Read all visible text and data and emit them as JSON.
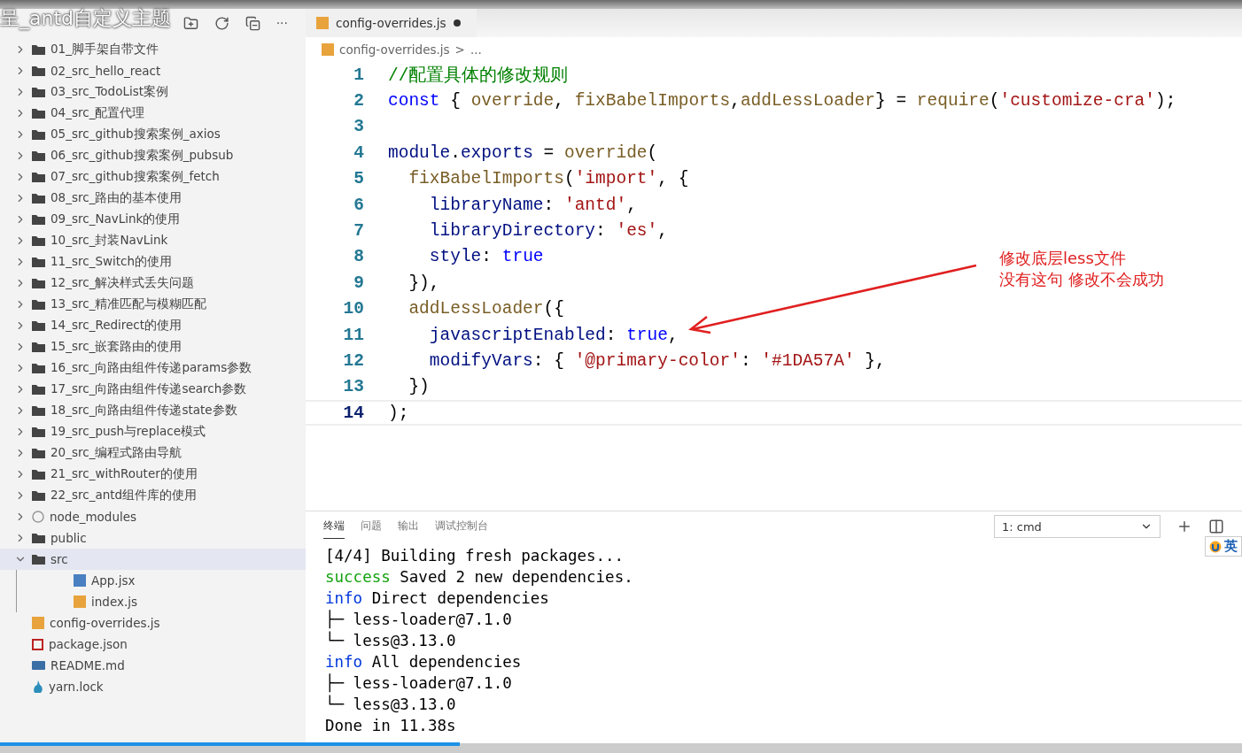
{
  "video_title": "呈_antd自定义主题",
  "explorer": {
    "more": "···",
    "items": [
      {
        "name": "01_脚手架自带文件",
        "kind": "folder",
        "expanded": false,
        "selected": false
      },
      {
        "name": "02_src_hello_react",
        "kind": "folder",
        "expanded": false,
        "selected": false
      },
      {
        "name": "03_src_TodoList案例",
        "kind": "folder",
        "expanded": false,
        "selected": false
      },
      {
        "name": "04_src_配置代理",
        "kind": "folder",
        "expanded": false,
        "selected": false
      },
      {
        "name": "05_src_github搜索案例_axios",
        "kind": "folder",
        "expanded": false,
        "selected": false
      },
      {
        "name": "06_src_github搜索案例_pubsub",
        "kind": "folder",
        "expanded": false,
        "selected": false
      },
      {
        "name": "07_src_github搜索案例_fetch",
        "kind": "folder",
        "expanded": false,
        "selected": false
      },
      {
        "name": "08_src_路由的基本使用",
        "kind": "folder",
        "expanded": false,
        "selected": false
      },
      {
        "name": "09_src_NavLink的使用",
        "kind": "folder",
        "expanded": false,
        "selected": false
      },
      {
        "name": "10_src_封装NavLink",
        "kind": "folder",
        "expanded": false,
        "selected": false
      },
      {
        "name": "11_src_Switch的使用",
        "kind": "folder",
        "expanded": false,
        "selected": false
      },
      {
        "name": "12_src_解决样式丢失问题",
        "kind": "folder",
        "expanded": false,
        "selected": false
      },
      {
        "name": "13_src_精准匹配与模糊匹配",
        "kind": "folder",
        "expanded": false,
        "selected": false
      },
      {
        "name": "14_src_Redirect的使用",
        "kind": "folder",
        "expanded": false,
        "selected": false
      },
      {
        "name": "15_src_嵌套路由的使用",
        "kind": "folder",
        "expanded": false,
        "selected": false
      },
      {
        "name": "16_src_向路由组件传递params参数",
        "kind": "folder",
        "expanded": false,
        "selected": false
      },
      {
        "name": "17_src_向路由组件传递search参数",
        "kind": "folder",
        "expanded": false,
        "selected": false
      },
      {
        "name": "18_src_向路由组件传递state参数",
        "kind": "folder",
        "expanded": false,
        "selected": false
      },
      {
        "name": "19_src_push与replace模式",
        "kind": "folder",
        "expanded": false,
        "selected": false
      },
      {
        "name": "20_src_编程式路由导航",
        "kind": "folder",
        "expanded": false,
        "selected": false
      },
      {
        "name": "21_src_withRouter的使用",
        "kind": "folder",
        "expanded": false,
        "selected": false
      },
      {
        "name": "22_src_antd组件库的使用",
        "kind": "folder",
        "expanded": false,
        "selected": false
      },
      {
        "name": "node_modules",
        "kind": "node",
        "expanded": false,
        "selected": false
      },
      {
        "name": "public",
        "kind": "folder",
        "expanded": false,
        "selected": false
      },
      {
        "name": "src",
        "kind": "folder",
        "expanded": true,
        "selected": true,
        "children": [
          {
            "name": "App.jsx",
            "kind": "jsx",
            "selected": false
          },
          {
            "name": "index.js",
            "kind": "js",
            "selected": false
          }
        ]
      },
      {
        "name": "config-overrides.js",
        "kind": "js",
        "selected": false
      },
      {
        "name": "package.json",
        "kind": "json",
        "selected": false
      },
      {
        "name": "README.md",
        "kind": "md",
        "selected": false
      },
      {
        "name": "yarn.lock",
        "kind": "yarn",
        "selected": false
      }
    ]
  },
  "editor": {
    "tab": {
      "name": "config-overrides.js",
      "modified": true
    },
    "breadcrumb": [
      "config-overrides.js",
      ">",
      "..."
    ],
    "lines": [
      {
        "number": "1",
        "current": false,
        "tokens": [
          {
            "text": "//配置具体的修改规则",
            "kind": "comment"
          }
        ]
      },
      {
        "number": "2",
        "current": false,
        "tokens": [
          {
            "text": "const",
            "kind": "keyword"
          },
          {
            "text": " { ",
            "kind": "plain"
          },
          {
            "text": "override",
            "kind": "func"
          },
          {
            "text": ", ",
            "kind": "plain"
          },
          {
            "text": "fixBabelImports",
            "kind": "func"
          },
          {
            "text": ",",
            "kind": "plain"
          },
          {
            "text": "addLessLoader",
            "kind": "func"
          },
          {
            "text": "} = ",
            "kind": "plain"
          },
          {
            "text": "require",
            "kind": "func"
          },
          {
            "text": "(",
            "kind": "plain"
          },
          {
            "text": "'customize-cra'",
            "kind": "string"
          },
          {
            "text": ");",
            "kind": "plain"
          }
        ]
      },
      {
        "number": "3",
        "current": false
      },
      {
        "number": "4",
        "current": false,
        "tokens": [
          {
            "text": "module",
            "kind": "prop"
          },
          {
            "text": ".",
            "kind": "plain"
          },
          {
            "text": "exports",
            "kind": "prop"
          },
          {
            "text": " = ",
            "kind": "plain"
          },
          {
            "text": "override",
            "kind": "func"
          },
          {
            "text": "(",
            "kind": "plain"
          }
        ]
      },
      {
        "number": "5",
        "current": false,
        "tokens": [
          {
            "text": "  fixBabelImports",
            "kind": "func"
          },
          {
            "text": "(",
            "kind": "plain"
          },
          {
            "text": "'import'",
            "kind": "string"
          },
          {
            "text": ", {",
            "kind": "plain"
          }
        ]
      },
      {
        "number": "6",
        "current": false,
        "tokens": [
          {
            "text": "    libraryName",
            "kind": "prop"
          },
          {
            "text": ": ",
            "kind": "plain"
          },
          {
            "text": "'antd'",
            "kind": "string"
          },
          {
            "text": ",",
            "kind": "plain"
          }
        ]
      },
      {
        "number": "7",
        "current": false,
        "tokens": [
          {
            "text": "    libraryDirectory",
            "kind": "prop"
          },
          {
            "text": ": ",
            "kind": "plain"
          },
          {
            "text": "'es'",
            "kind": "string"
          },
          {
            "text": ",",
            "kind": "plain"
          }
        ]
      },
      {
        "number": "8",
        "current": false,
        "tokens": [
          {
            "text": "    style",
            "kind": "prop"
          },
          {
            "text": ": ",
            "kind": "plain"
          },
          {
            "text": "true",
            "kind": "keyword"
          }
        ]
      },
      {
        "number": "9",
        "current": false,
        "tokens": [
          {
            "text": "  }),",
            "kind": "plain"
          }
        ]
      },
      {
        "number": "10",
        "current": false,
        "tokens": [
          {
            "text": "  addLessLoader",
            "kind": "func"
          },
          {
            "text": "({",
            "kind": "plain"
          }
        ]
      },
      {
        "number": "11",
        "current": false,
        "tokens": [
          {
            "text": "    javascriptEnabled",
            "kind": "prop"
          },
          {
            "text": ": ",
            "kind": "plain"
          },
          {
            "text": "true",
            "kind": "keyword"
          },
          {
            "text": ",",
            "kind": "plain"
          }
        ]
      },
      {
        "number": "12",
        "current": false,
        "tokens": [
          {
            "text": "    modifyVars",
            "kind": "prop"
          },
          {
            "text": ": { ",
            "kind": "plain"
          },
          {
            "text": "'@primary-color'",
            "kind": "string"
          },
          {
            "text": ": ",
            "kind": "plain"
          },
          {
            "text": "'#1DA57A'",
            "kind": "string"
          },
          {
            "text": " },",
            "kind": "plain"
          }
        ]
      },
      {
        "number": "13",
        "current": false,
        "tokens": [
          {
            "text": "  })",
            "kind": "plain"
          }
        ]
      },
      {
        "number": "14",
        "current": true,
        "tokens": [
          {
            "text": ");",
            "kind": "plain"
          }
        ]
      }
    ]
  },
  "annotation": {
    "lines": [
      "修改底层less文件",
      "没有这句 修改不会成功"
    ]
  },
  "panel": {
    "tabs": [
      {
        "label": "终端",
        "selected": true
      },
      {
        "label": "问题",
        "selected": false
      },
      {
        "label": "输出",
        "selected": false
      },
      {
        "label": "调试控制台",
        "selected": false
      }
    ],
    "terminal_select": "1: cmd",
    "ime": "英",
    "terminal": [
      [
        {
          "text": "[4/4] Building fresh packages...",
          "kind": "plain"
        }
      ],
      [
        {
          "text": "success",
          "kind": "success"
        },
        {
          "text": " Saved 2 new dependencies.",
          "kind": "plain"
        }
      ],
      [
        {
          "text": "info",
          "kind": "info"
        },
        {
          "text": " Direct dependencies",
          "kind": "plain"
        }
      ],
      [
        {
          "text": "├─ less-loader@7.1.0",
          "kind": "plain"
        }
      ],
      [
        {
          "text": "└─ less@3.13.0",
          "kind": "plain"
        }
      ],
      [
        {
          "text": "info",
          "kind": "info"
        },
        {
          "text": " All dependencies",
          "kind": "plain"
        }
      ],
      [
        {
          "text": "├─ less-loader@7.1.0",
          "kind": "plain"
        }
      ],
      [
        {
          "text": "└─ less@3.13.0",
          "kind": "plain"
        }
      ],
      [
        {
          "text": "Done in 11.38s",
          "kind": "plain"
        }
      ]
    ]
  },
  "player": {
    "level": 0.37
  }
}
